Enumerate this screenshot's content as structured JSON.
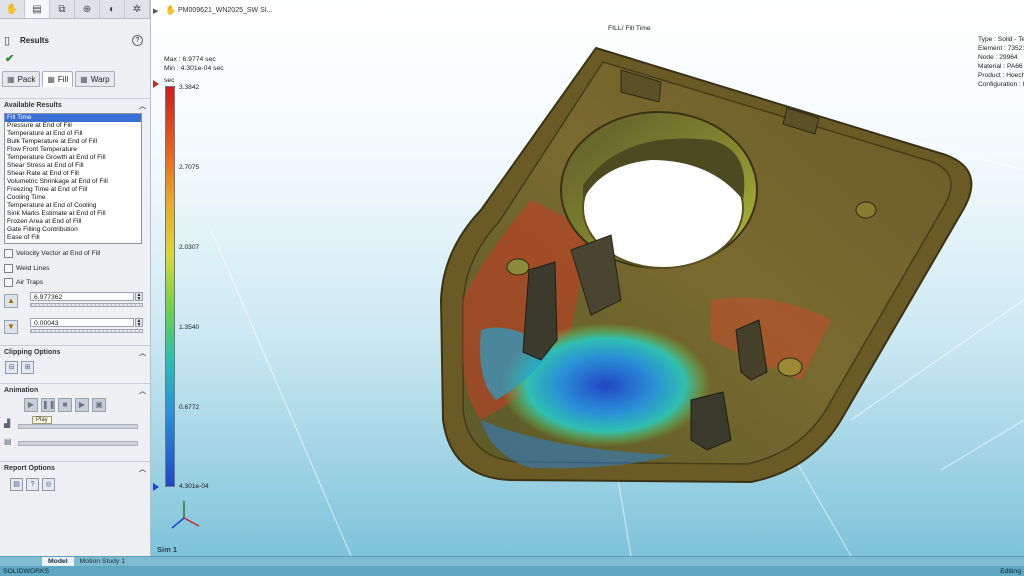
{
  "panel": {
    "tabs": [
      {
        "icon": "featuremanager-icon",
        "glyph": "✋"
      },
      {
        "icon": "propertymanager-icon",
        "glyph": "▤"
      },
      {
        "icon": "configuration-icon",
        "glyph": "⧉"
      },
      {
        "icon": "target-icon",
        "glyph": "⊕"
      },
      {
        "icon": "appearance-icon",
        "glyph": "◐"
      },
      {
        "icon": "plastics-icon",
        "glyph": "✲"
      }
    ],
    "title": "Results",
    "help": "?",
    "ok_glyph": "✔",
    "result_tabs": [
      {
        "label": "Pack",
        "icon": "pack-icon"
      },
      {
        "label": "Fill",
        "icon": "fill-icon",
        "active": true
      },
      {
        "label": "Warp",
        "icon": "warp-icon"
      }
    ],
    "available_results_header": "Available Results",
    "available_results": [
      "Fill Time",
      "Pressure at End of Fill",
      "Temperature at End of Fill",
      "Bulk Temperature at End of Fill",
      "Flow Front Temperature",
      "Temperature Growth at End of Fill",
      "Shear Stress at End of Fill",
      "Shear Rate at End of Fill",
      "Volumetric Shrinkage at End of Fill",
      "Freezing Time at End of Fill",
      "Cooling Time",
      "Temperature at End of Cooling",
      "Sink Marks Estimate at End of Fill",
      "Frozen Area at End of Fill",
      "Gate Filling Contribution",
      "Ease of Fill"
    ],
    "selected_result_index": 0,
    "checkboxes": {
      "velocity_vector": "Velocity Vector at End of Fill",
      "weld_lines": "Weld Lines",
      "air_traps": "Air Traps"
    },
    "max_value": "6.977362",
    "min_value": "0.00043",
    "clipping_header": "Clipping Options",
    "animation_header": "Animation",
    "play_tooltip": "Play",
    "report_header": "Report Options"
  },
  "viewport": {
    "part_name": "PM009621_WN2025_SW SI...",
    "plot_title": "FILL/ Fill Time",
    "max_text": "Max : 6.9774 sec",
    "min_text": "Min : 4.301e-04 sec",
    "unit": "sec",
    "legend_ticks": [
      "3.3842",
      "2.7075",
      "2.0307",
      "1.3540",
      "0.6772",
      "4.301e-04"
    ],
    "info_lines": [
      "Type : Solid - Te",
      "Element : 73521",
      "Node : 29964",
      "Material : PA66",
      "Product : Hoech",
      "Configuration : I"
    ],
    "sim_label": "Sim 1",
    "colors": {
      "max": "#cc1f1f",
      "mid": "#6fcf4a",
      "min": "#2346c4"
    }
  },
  "bottom_tabs": [
    "",
    "Model",
    "Motion Study 1"
  ],
  "status_left": "SOLIDWORKS",
  "status_right": "Editing"
}
